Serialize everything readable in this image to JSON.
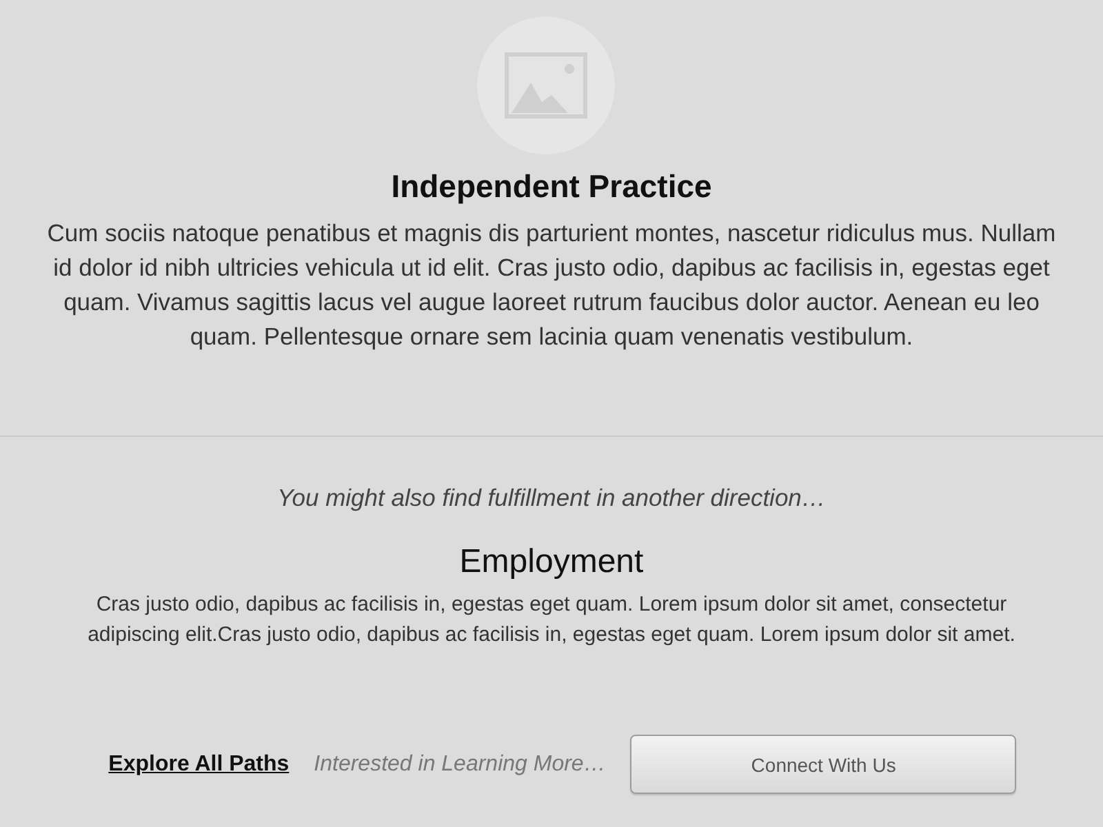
{
  "hero": {
    "title": "Independent Practice",
    "description": "Cum sociis natoque penatibus et magnis dis parturient montes, nascetur ridiculus mus. Nullam id dolor id nibh ultricies vehicula ut id elit. Cras justo odio, dapibus ac facilisis in, egestas eget quam. Vivamus sagittis lacus vel augue laoreet rutrum faucibus dolor auctor. Aenean eu leo quam. Pellentesque ornare sem lacinia quam venenatis vestibulum."
  },
  "suggestion": {
    "prompt": "You might also find fulfillment in another direction…",
    "title": "Employment",
    "description": "Cras justo odio, dapibus ac facilisis in, egestas eget quam. Lorem ipsum dolor sit amet, consectetur adipiscing elit.Cras justo odio, dapibus ac facilisis in, egestas eget quam. Lorem ipsum dolor sit amet."
  },
  "footer": {
    "link": "Explore All Paths",
    "prompt": "Interested in Learning More…",
    "button": "Connect With Us"
  }
}
